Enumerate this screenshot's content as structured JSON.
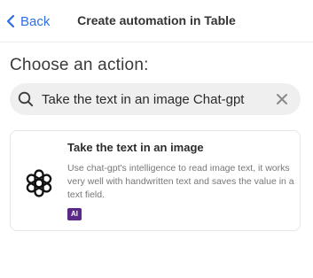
{
  "header": {
    "back_label": "Back",
    "title": "Create automation in Table"
  },
  "main": {
    "heading": "Choose an action:",
    "search": {
      "value": "Take the text in an image Chat-gpt",
      "placeholder": ""
    },
    "actions": [
      {
        "title": "Take the text in an image",
        "description": "Use chat-gpt's intelligence to read image text, it works very well with handwritten text and saves the value in a text field.",
        "badge": "AI",
        "icon": "openai-logo-icon"
      }
    ]
  },
  "colors": {
    "accent": "#2f6fe0",
    "search_bg": "#efefef",
    "badge_bg": "#5b2a86"
  }
}
